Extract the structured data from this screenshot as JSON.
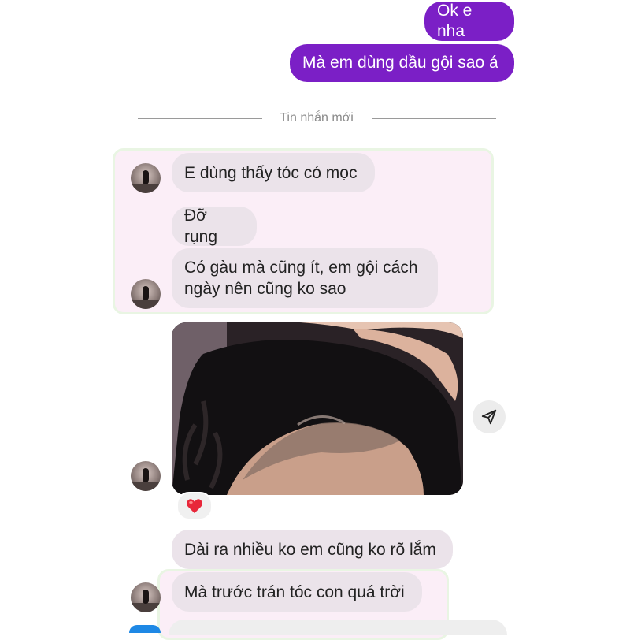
{
  "messages_out": [
    {
      "text": "Ok e nha"
    },
    {
      "text": "Mà em dùng dầu gội sao á"
    }
  ],
  "divider": {
    "label": "Tin nhắn mới"
  },
  "messages_in": [
    {
      "text": "E dùng thấy tóc có mọc"
    },
    {
      "text": "Đỡ rụng"
    },
    {
      "line1": "Có gàu mà cũng ít, em gội cách",
      "line2": "ngày nên cũng ko sao"
    },
    {
      "text": "Dài ra nhiều ko em cũng ko rõ lắm"
    },
    {
      "text": "Mà trước trán tóc con quá trời"
    }
  ],
  "photo": {
    "description_icon": "hair-photo"
  },
  "reaction": {
    "emoji": "❤️"
  },
  "colors": {
    "outgoing": "#7b1fc6",
    "incoming": "#ebe3ea",
    "highlight": "#fbeef7"
  }
}
